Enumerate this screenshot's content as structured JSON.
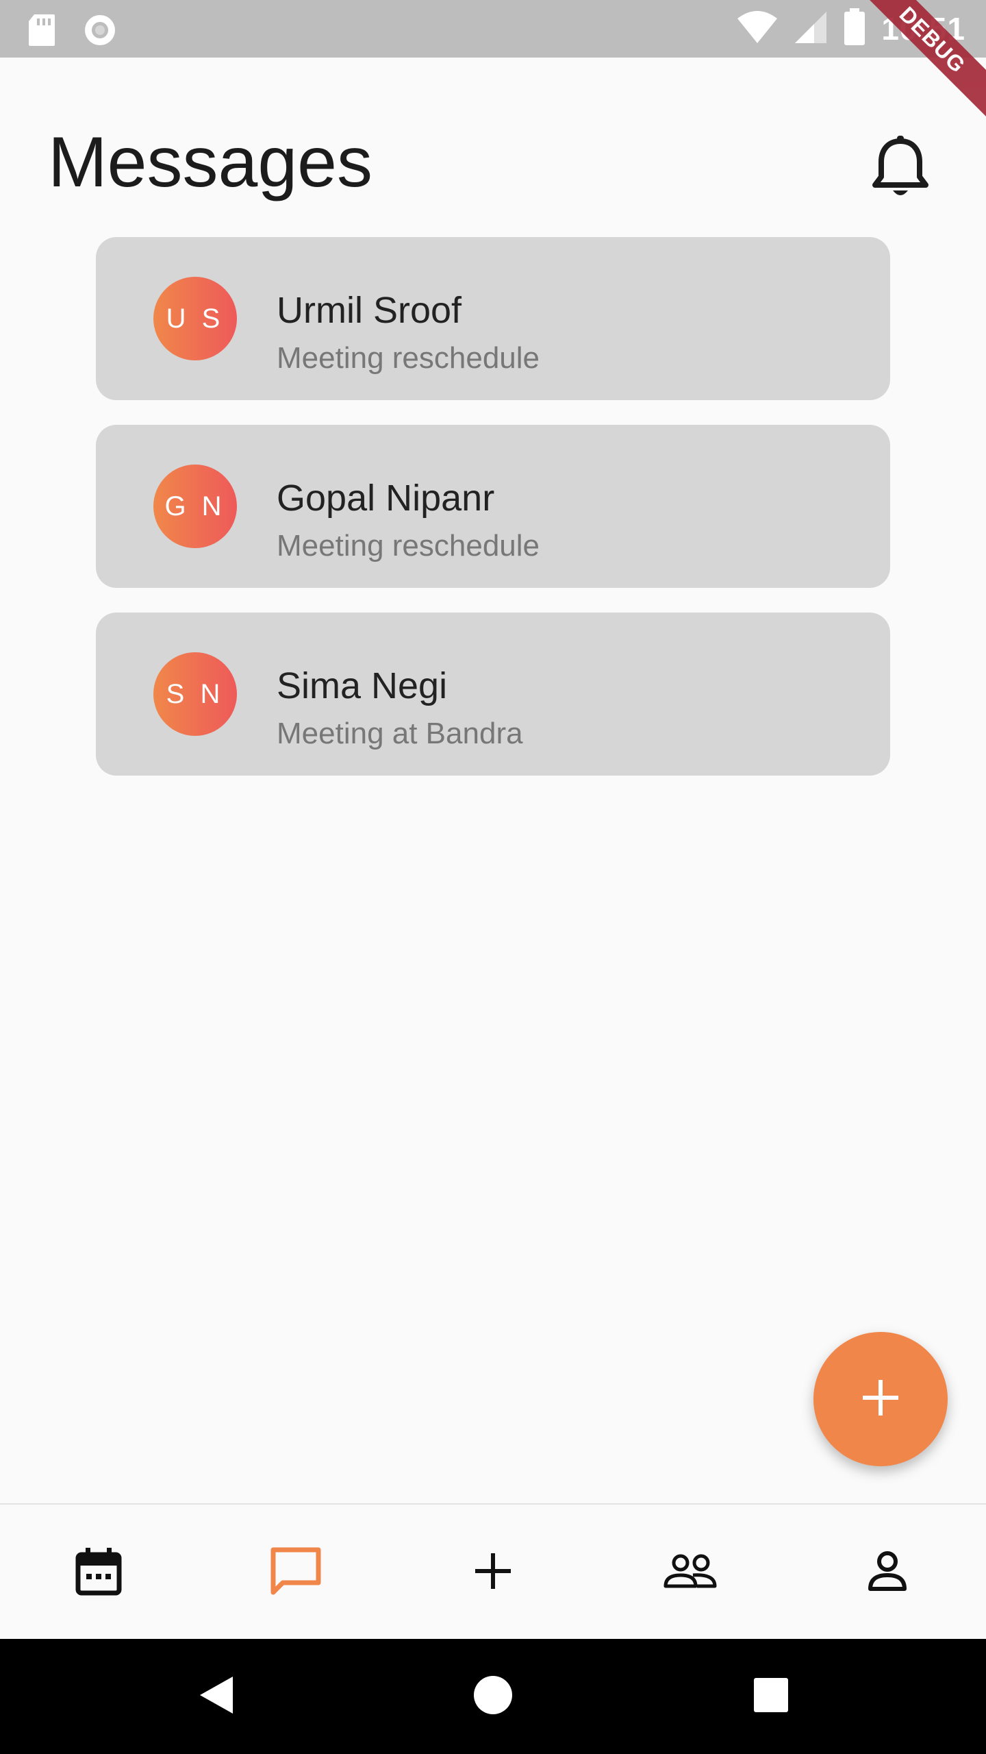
{
  "status_bar": {
    "time": "10:51",
    "debug_label": "DEBUG"
  },
  "header": {
    "title": "Messages"
  },
  "messages": [
    {
      "initials": "U S",
      "name": "Urmil Sroof",
      "subject": "Meeting reschedule"
    },
    {
      "initials": "G N",
      "name": "Gopal Nipanr",
      "subject": "Meeting reschedule"
    },
    {
      "initials": "S N",
      "name": "Sima Negi",
      "subject": "Meeting at Bandra"
    }
  ],
  "bottom_nav": {
    "items": [
      {
        "icon": "calendar-icon",
        "active": false
      },
      {
        "icon": "chat-icon",
        "active": true
      },
      {
        "icon": "plus-icon",
        "active": false
      },
      {
        "icon": "group-icon",
        "active": false
      },
      {
        "icon": "person-icon",
        "active": false
      }
    ]
  },
  "colors": {
    "accent": "#f1864a",
    "avatar_gradient_start": "#f0874a",
    "avatar_gradient_end": "#ee5a5a",
    "card_background": "#d6d6d6",
    "debug_ribbon": "#a52a3a"
  }
}
